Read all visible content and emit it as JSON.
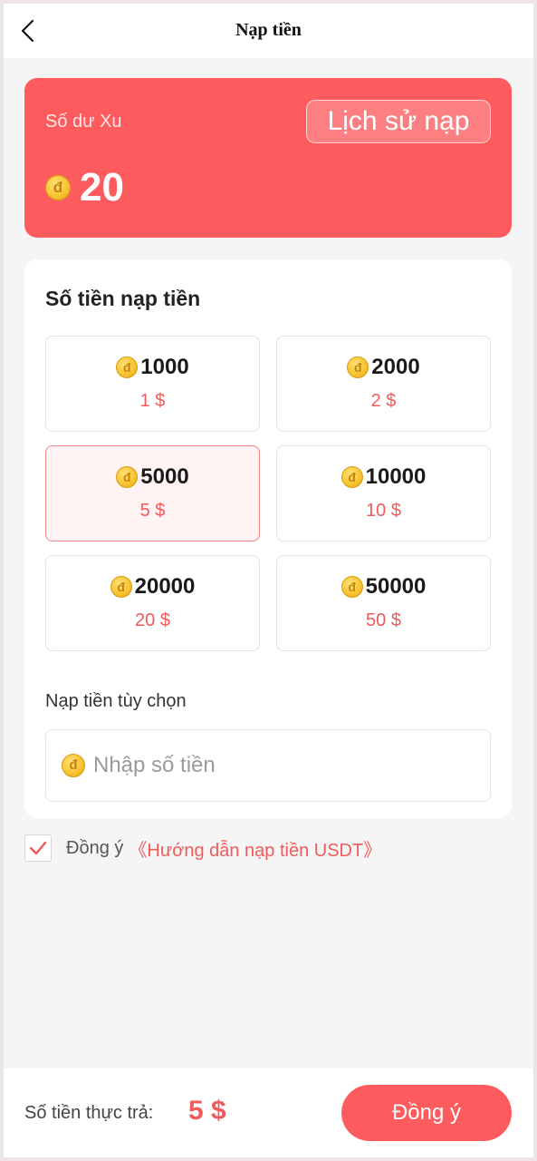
{
  "header": {
    "title": "Nạp tiền",
    "back_icon": "chevron-left-icon"
  },
  "balance": {
    "label": "Số dư Xu",
    "history_button": "Lịch sử nạp",
    "value": "20",
    "coin_glyph": "đ"
  },
  "recharge": {
    "title": "Số tiền nạp tiền",
    "packages": [
      {
        "coins": "1000",
        "price": "1 $",
        "selected": false
      },
      {
        "coins": "2000",
        "price": "2 $",
        "selected": false
      },
      {
        "coins": "5000",
        "price": "5 $",
        "selected": true
      },
      {
        "coins": "10000",
        "price": "10 $",
        "selected": false
      },
      {
        "coins": "20000",
        "price": "20 $",
        "selected": false
      },
      {
        "coins": "50000",
        "price": "50 $",
        "selected": false
      }
    ],
    "custom_label": "Nạp tiền tùy chọn",
    "custom_placeholder": "Nhập số tiền"
  },
  "agreement": {
    "checked": true,
    "text": "Đồng ý",
    "link": "《Hướng dẫn nạp tiền USDT》"
  },
  "footer": {
    "pay_label": "Số tiền thực trả:",
    "pay_amount": "5 $",
    "confirm_button": "Đồng ý"
  },
  "colors": {
    "accent": "#fe5b5e",
    "price": "#f05a5b",
    "coin": "#f8c533"
  }
}
